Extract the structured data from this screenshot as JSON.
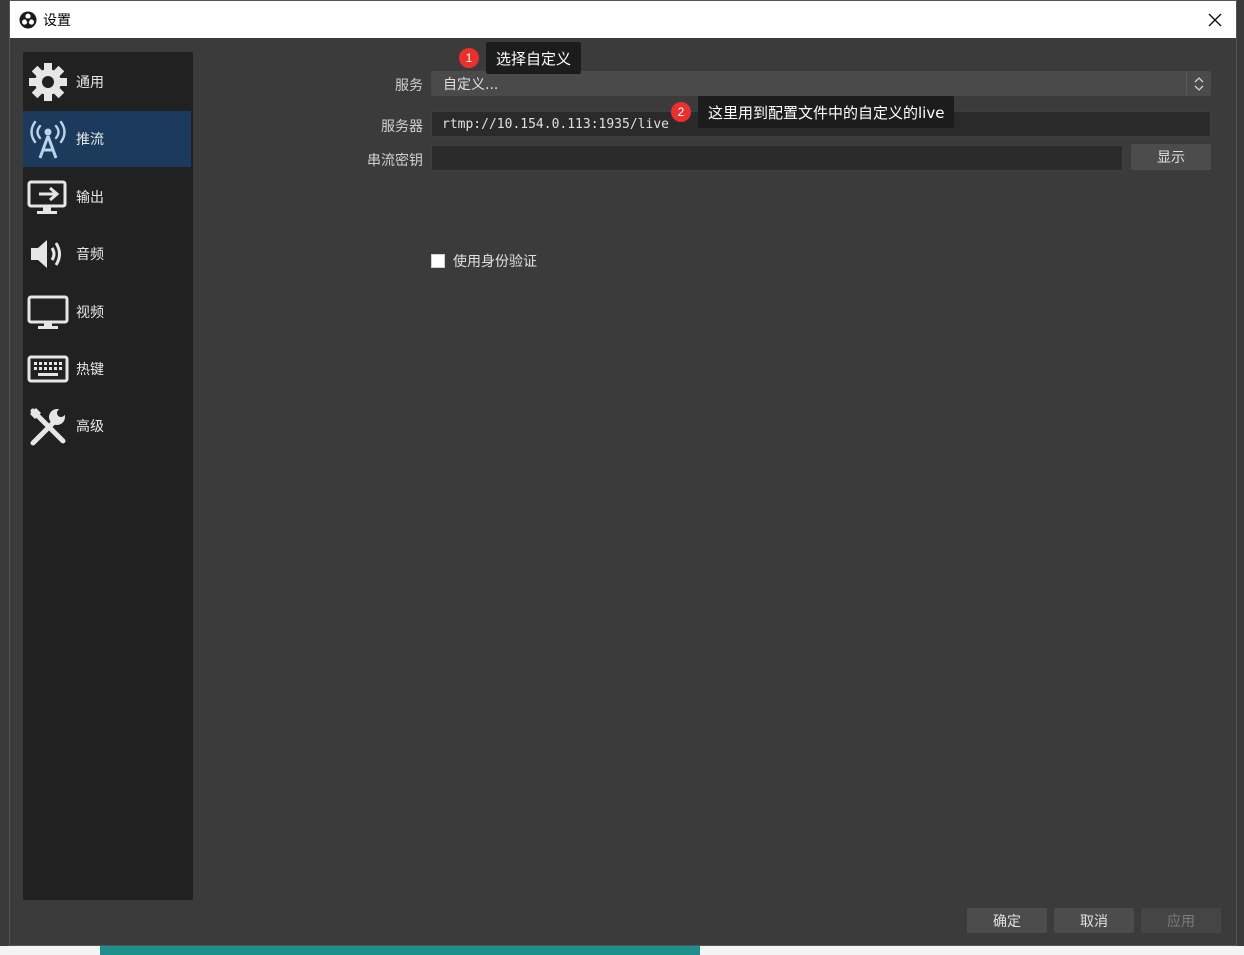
{
  "window": {
    "title": "设置",
    "close_icon": "close-icon"
  },
  "sidebar": {
    "items": [
      {
        "label": "通用",
        "icon": "gear-icon"
      },
      {
        "label": "推流",
        "icon": "broadcast-tower-icon",
        "active": true
      },
      {
        "label": "输出",
        "icon": "output-monitor-icon"
      },
      {
        "label": "音频",
        "icon": "speaker-icon"
      },
      {
        "label": "视频",
        "icon": "monitor-icon"
      },
      {
        "label": "热键",
        "icon": "keyboard-icon"
      },
      {
        "label": "高级",
        "icon": "tools-icon"
      }
    ]
  },
  "form": {
    "service_label": "服务",
    "service_value": "自定义...",
    "server_label": "服务器",
    "server_value": "rtmp://10.154.0.113:1935/live",
    "stream_key_label": "串流密钥",
    "stream_key_value": "",
    "show_button": "显示",
    "use_auth_label": "使用身份验证",
    "use_auth_checked": false
  },
  "annotations": [
    {
      "number": "1",
      "text": "选择自定义"
    },
    {
      "number": "2",
      "text": "这里用到配置文件中的自定义的live"
    }
  ],
  "footer": {
    "ok": "确定",
    "cancel": "取消",
    "apply": "应用"
  },
  "colors": {
    "sidebar_active": "#1b3a5c",
    "badge": "#e8312c",
    "dialog_bg": "#3b3b3b"
  }
}
